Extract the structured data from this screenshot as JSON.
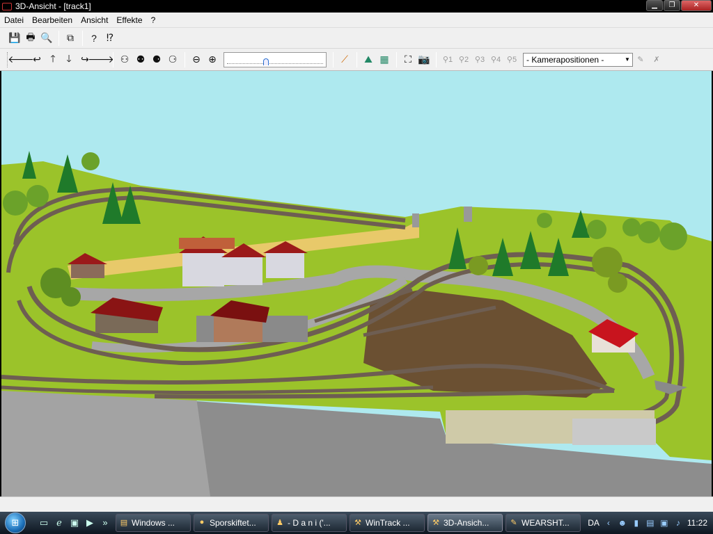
{
  "window": {
    "title": "3D-Ansicht - [track1]"
  },
  "menu": {
    "items": [
      "Datei",
      "Bearbeiten",
      "Ansicht",
      "Effekte",
      "?"
    ]
  },
  "toolbar2": {
    "camera_select_value": "- Kamerapositionen -"
  },
  "taskbar": {
    "tasks": [
      {
        "label": "Windows ...",
        "icon": "folder-icon"
      },
      {
        "label": "Sporskiftet...",
        "icon": "firefox-icon"
      },
      {
        "label": "- D a n i ('...",
        "icon": "messenger-icon"
      },
      {
        "label": "WinTrack ...",
        "icon": "wintrack-icon"
      },
      {
        "label": "3D-Ansich...",
        "icon": "wintrack-3d-icon"
      },
      {
        "label": "WEARSHT...",
        "icon": "paint-icon"
      }
    ],
    "tray_language": "DA",
    "clock": "11:22"
  },
  "colors": {
    "sky": "#aee9ef",
    "grass": "#9bc32a",
    "cliff": "#8f8f8f",
    "titlebar": "#000000"
  }
}
